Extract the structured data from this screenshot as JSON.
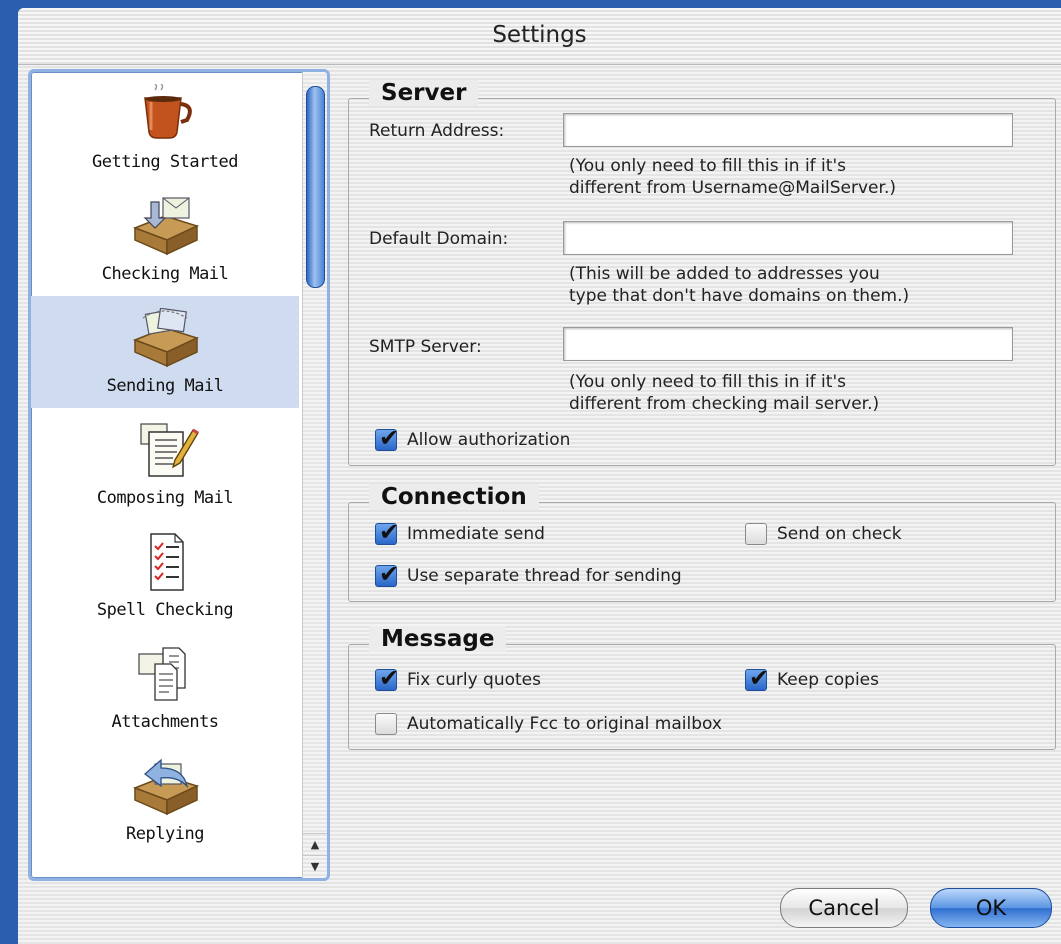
{
  "window": {
    "title": "Settings"
  },
  "sidebar": {
    "items": [
      {
        "label": "Getting Started",
        "icon": "coffee-cup-icon",
        "selected": false
      },
      {
        "label": "Checking Mail",
        "icon": "mail-tray-in-icon",
        "selected": false
      },
      {
        "label": "Sending Mail",
        "icon": "mail-tray-out-icon",
        "selected": true
      },
      {
        "label": "Composing Mail",
        "icon": "document-pencil-icon",
        "selected": false
      },
      {
        "label": "Spell Checking",
        "icon": "checklist-icon",
        "selected": false
      },
      {
        "label": "Attachments",
        "icon": "attachment-pages-icon",
        "selected": false
      },
      {
        "label": "Replying",
        "icon": "reply-tray-icon",
        "selected": false
      }
    ],
    "scroll_up_glyph": "▲",
    "scroll_down_glyph": "▼"
  },
  "server": {
    "title": "Server",
    "return_address": {
      "label": "Return Address:",
      "value": ""
    },
    "return_hint_1": "(You only need to fill this in if it's",
    "return_hint_2": "different from Username@MailServer.)",
    "default_domain": {
      "label": "Default Domain:",
      "value": ""
    },
    "domain_hint_1": "(This will be added to addresses you",
    "domain_hint_2": "type that don't have domains on them.)",
    "smtp_server": {
      "label": "SMTP Server:",
      "value": ""
    },
    "smtp_hint_1": "(You only need to fill this in if it's",
    "smtp_hint_2": "different from checking mail server.)",
    "allow_auth": {
      "label": "Allow authorization",
      "checked": true
    }
  },
  "connection": {
    "title": "Connection",
    "immediate_send": {
      "label": "Immediate send",
      "checked": true
    },
    "send_on_check": {
      "label": "Send on check",
      "checked": false
    },
    "separate_thread": {
      "label": "Use separate thread for sending",
      "checked": true
    }
  },
  "message": {
    "title": "Message",
    "fix_curly": {
      "label": "Fix curly quotes",
      "checked": true
    },
    "keep_copies": {
      "label": "Keep copies",
      "checked": true
    },
    "auto_fcc": {
      "label": "Automatically Fcc to original mailbox",
      "checked": false
    }
  },
  "buttons": {
    "cancel": "Cancel",
    "ok": "OK"
  },
  "colors": {
    "accent": "#2a66c8",
    "selection": "#cfdbef",
    "desktop": "#2a5fb0"
  }
}
